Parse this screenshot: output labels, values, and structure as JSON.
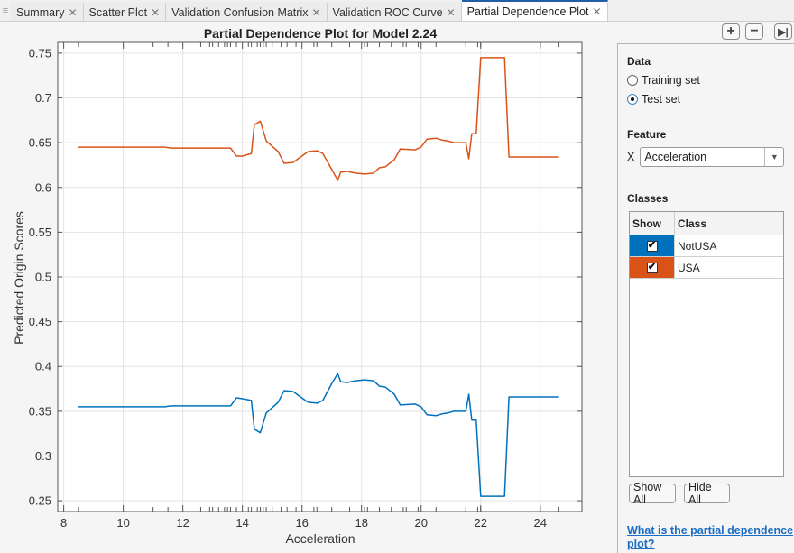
{
  "tabs": [
    {
      "label": "Summary",
      "active": false
    },
    {
      "label": "Scatter Plot",
      "active": false
    },
    {
      "label": "Validation Confusion Matrix",
      "active": false
    },
    {
      "label": "Validation ROC Curve",
      "active": false
    },
    {
      "label": "Partial Dependence Plot",
      "active": true
    }
  ],
  "toolbar": {
    "zoom_in_icon": "plus-icon",
    "zoom_out_icon": "minus-icon",
    "collapse_icon": "skip-to-end-icon",
    "zoom_in_glyph": "+",
    "zoom_out_glyph": "−",
    "collapse_glyph": "▶|"
  },
  "panel": {
    "data_title": "Data",
    "data_options": [
      {
        "label": "Training set",
        "selected": false
      },
      {
        "label": "Test set",
        "selected": true
      }
    ],
    "feature_title": "Feature",
    "feature_axis_label": "X",
    "feature_value": "Acceleration",
    "classes_title": "Classes",
    "classes_columns": [
      "Show",
      "Class"
    ],
    "classes": [
      {
        "name": "NotUSA",
        "shown": true,
        "color": "#0072bd"
      },
      {
        "name": "USA",
        "shown": true,
        "color": "#d95319"
      }
    ],
    "show_all_label": "Show All",
    "hide_all_label": "Hide All",
    "help_link": "What is the partial dependence plot?"
  },
  "chart_data": {
    "type": "line",
    "title": "Partial Dependence Plot for Model 2.24",
    "xlabel": "Acceleration",
    "ylabel": "Predicted Origin Scores",
    "xlim": [
      7.8,
      25.4
    ],
    "ylim": [
      0.238,
      0.762
    ],
    "xticks": [
      8,
      10,
      12,
      14,
      16,
      18,
      20,
      22,
      24
    ],
    "yticks": [
      0.25,
      0.3,
      0.35,
      0.4,
      0.45,
      0.5,
      0.55,
      0.6,
      0.65,
      0.7,
      0.75
    ],
    "ytick_labels": [
      "0.25",
      "0.3",
      "0.35",
      "0.4",
      "0.45",
      "0.5",
      "0.55",
      "0.6",
      "0.65",
      "0.7",
      "0.75"
    ],
    "grid": true,
    "rug_x": [
      8.5,
      11.0,
      11.5,
      11.6,
      12.6,
      12.9,
      13.0,
      13.2,
      13.4,
      13.5,
      13.6,
      13.8,
      14.2,
      14.3,
      14.5,
      14.6,
      14.7,
      14.8,
      15.0,
      15.3,
      15.5,
      15.8,
      16.4,
      16.5,
      17.0,
      17.6,
      18.1,
      18.2,
      18.6,
      19.0,
      19.4,
      19.5,
      19.9,
      20.5,
      21.5,
      21.9,
      22.0,
      24.0,
      24.6
    ],
    "x": [
      8.5,
      11.4,
      11.6,
      13.6,
      13.8,
      14.0,
      14.3,
      14.4,
      14.6,
      14.8,
      15.2,
      15.4,
      15.7,
      16.2,
      16.5,
      16.7,
      17.0,
      17.2,
      17.3,
      17.5,
      17.8,
      18.1,
      18.4,
      18.6,
      18.8,
      19.1,
      19.3,
      19.8,
      20.0,
      20.2,
      20.5,
      20.7,
      20.9,
      21.1,
      21.5,
      21.6,
      21.7,
      21.85,
      22.0,
      22.8,
      22.95,
      24.6
    ],
    "series": [
      {
        "name": "NotUSA",
        "color": "#0072bd",
        "values": [
          0.355,
          0.355,
          0.356,
          0.356,
          0.365,
          0.364,
          0.362,
          0.33,
          0.326,
          0.348,
          0.36,
          0.373,
          0.372,
          0.36,
          0.359,
          0.362,
          0.381,
          0.392,
          0.383,
          0.382,
          0.384,
          0.385,
          0.384,
          0.378,
          0.377,
          0.369,
          0.357,
          0.358,
          0.355,
          0.346,
          0.345,
          0.347,
          0.348,
          0.35,
          0.35,
          0.369,
          0.34,
          0.34,
          0.255,
          0.255,
          0.366,
          0.366
        ]
      },
      {
        "name": "USA",
        "color": "#d95319",
        "values": [
          0.645,
          0.645,
          0.644,
          0.644,
          0.635,
          0.635,
          0.638,
          0.67,
          0.674,
          0.652,
          0.64,
          0.627,
          0.628,
          0.64,
          0.641,
          0.638,
          0.62,
          0.608,
          0.617,
          0.618,
          0.616,
          0.615,
          0.616,
          0.622,
          0.623,
          0.631,
          0.643,
          0.642,
          0.645,
          0.654,
          0.655,
          0.653,
          0.652,
          0.65,
          0.65,
          0.632,
          0.66,
          0.66,
          0.745,
          0.745,
          0.634,
          0.634
        ]
      }
    ]
  }
}
